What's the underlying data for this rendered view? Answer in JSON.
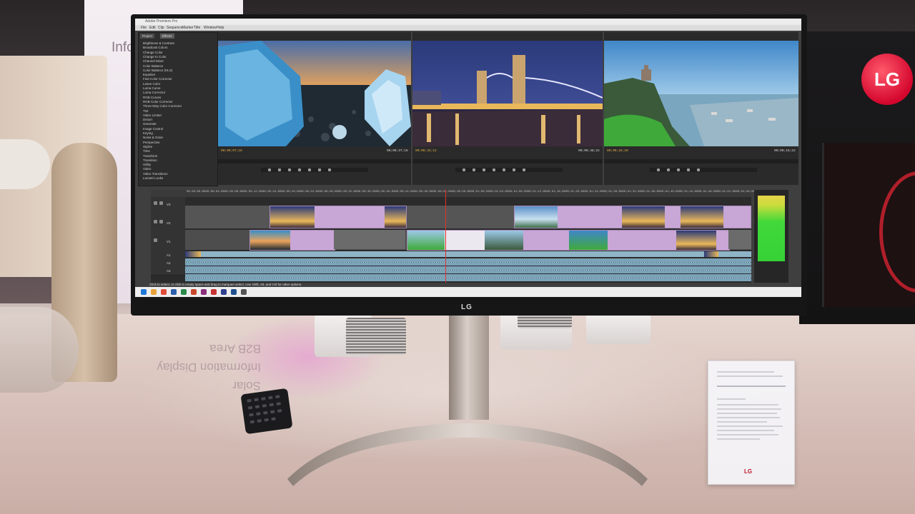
{
  "scene": {
    "booth_sign_text": "Info",
    "reflected_sign_lines": [
      "Solar",
      "Information Display",
      "B2B Area"
    ],
    "monitor_brand_chin": "LG",
    "brand_logo_letters": "LG",
    "placard_brand": "LG"
  },
  "premiere": {
    "menu_items": [
      "File",
      "Edit",
      "Clip",
      "Sequence",
      "Marker",
      "Title",
      "Window",
      "Help"
    ],
    "panels": {
      "effects_tabs": [
        "Project",
        "Effects"
      ],
      "effects_list": [
        "Brightness & Contrast",
        "Broadcast Colors",
        "Change Color",
        "Change to Color",
        "Channel Mixer",
        "Color Balance",
        "Color Balance (HLS)",
        "Equalize",
        "Fast Color Corrector",
        "Leave Color",
        "Luma Curve",
        "Luma Corrector",
        "RGB Curves",
        "RGB Color Corrector",
        "Three-Way Color Corrector",
        "Tint",
        "Video Limiter",
        "Distort",
        "Generate",
        "Image Control",
        "Keying",
        "Noise & Grain",
        "Perspective",
        "Stylize",
        "Time",
        "Transform",
        "Transition",
        "Utility",
        "Video",
        "Video Transitions",
        "Lumetri Looks"
      ]
    },
    "timecodes": {
      "monitor_1_in": "00;00;07;18",
      "monitor_1_out": "00;00;37;18",
      "monitor_2_in": "00;00;32;12",
      "monitor_2_out": "00;00;48;22",
      "monitor_3_in": "00;00;16;20",
      "monitor_3_out": "00;00;16;22"
    },
    "timeline_ruler": [
      "00;00;00;00",
      "00;00;04;00",
      "00;00;08;00",
      "00;00;12;00",
      "00;00;16;00",
      "00;00;20;00",
      "00;00;24;00",
      "00;00;28;00",
      "00;00;32;00",
      "00;00;36;00",
      "00;00;40;00",
      "00;00;44;00",
      "00;00;48;00",
      "00;00;52;00",
      "00;00;56;00",
      "00;01;00;00",
      "00;01;04;00",
      "00;01;08;00",
      "00;01;12;00",
      "00;01;16;00",
      "00;01;20;00",
      "00;01;24;00",
      "00;01;28;00",
      "00;01;32;00",
      "00;01;36;00",
      "00;01;40;00",
      "00;01;44;00",
      "00;01;48;00",
      "00;01;52;00",
      "00;01;56;00"
    ],
    "track_labels": [
      "V3",
      "V2",
      "V1",
      "A1",
      "A2",
      "A3"
    ],
    "status_text": "Click to select, or click in empty space and drag to marquee select. Use Shift, Alt, and Ctrl for other options.",
    "title_text": "Adobe Premiere Pro"
  },
  "colors": {
    "lg_red": "#d4062d",
    "clip_lavender": "#c8a6d6",
    "meter_green": "#36d236",
    "playhead_red": "#e0302a"
  }
}
